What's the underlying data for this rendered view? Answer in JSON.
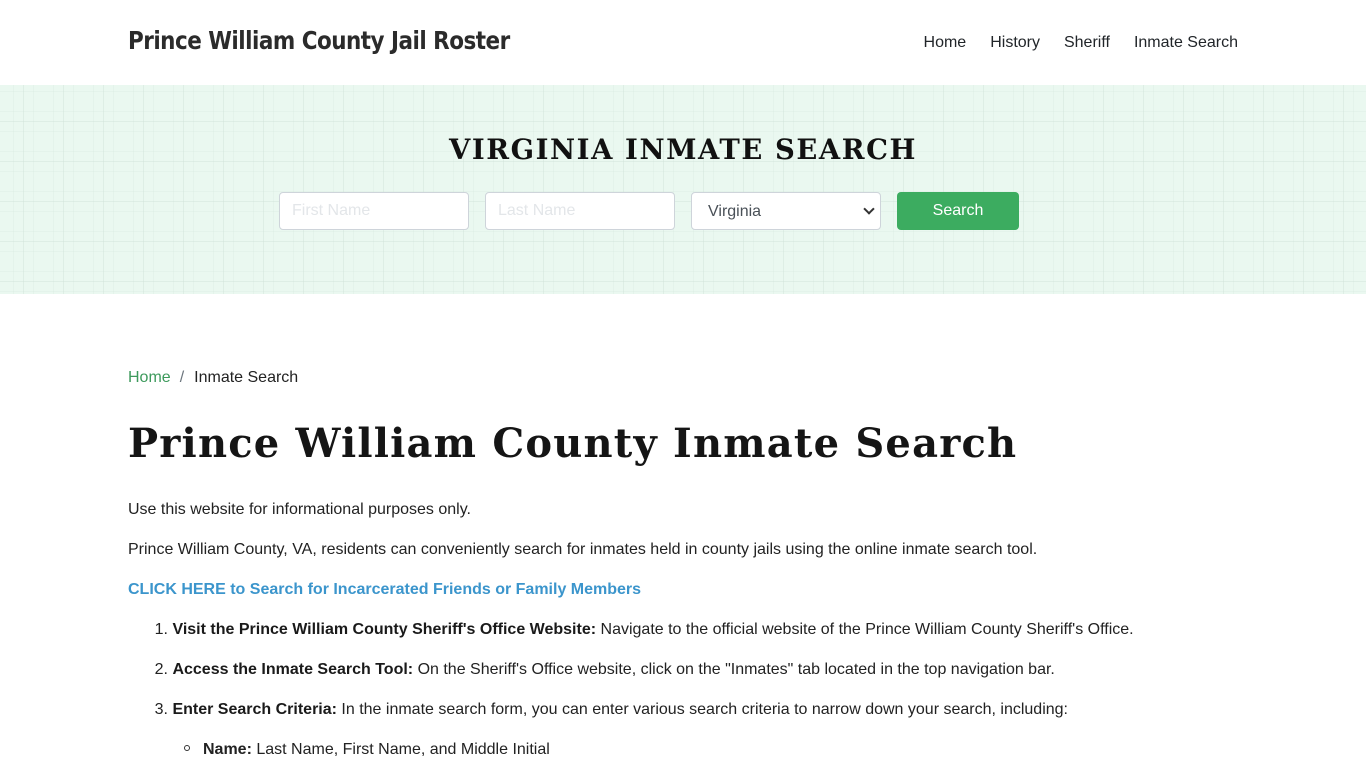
{
  "header": {
    "brand": "Prince William County Jail Roster",
    "nav": [
      {
        "label": "Home"
      },
      {
        "label": "History"
      },
      {
        "label": "Sheriff"
      },
      {
        "label": "Inmate Search"
      }
    ]
  },
  "hero": {
    "title": "VIRGINIA INMATE SEARCH",
    "first_name_placeholder": "First Name",
    "first_name_value": "",
    "last_name_placeholder": "Last Name",
    "last_name_value": "",
    "state_selected": "Virginia",
    "search_label": "Search",
    "accent_color": "#3cac60"
  },
  "breadcrumb": {
    "home": "Home",
    "separator": "/",
    "current": "Inmate Search"
  },
  "main": {
    "title": "Prince William County Inmate Search",
    "intro": "Use this website for informational purposes only.",
    "description": "Prince William County, VA, residents can conveniently search for inmates held in county jails using the online inmate search tool.",
    "cta": "CLICK HERE to Search for Incarcerated Friends or Family Members",
    "steps": [
      {
        "num": "1.",
        "title": "Visit the Prince William County Sheriff's Office Website:",
        "text": " Navigate to the official website of the Prince William County Sheriff's Office."
      },
      {
        "num": "2.",
        "title": "Access the Inmate Search Tool:",
        "text": " On the Sheriff's Office website, click on the \"Inmates\" tab located in the top navigation bar."
      },
      {
        "num": "3.",
        "title": "Enter Search Criteria:",
        "text": " In the inmate search form, you can enter various search criteria to narrow down your search, including:"
      }
    ],
    "criteria": [
      {
        "title": "Name:",
        "text": " Last Name, First Name, and Middle Initial"
      }
    ]
  }
}
